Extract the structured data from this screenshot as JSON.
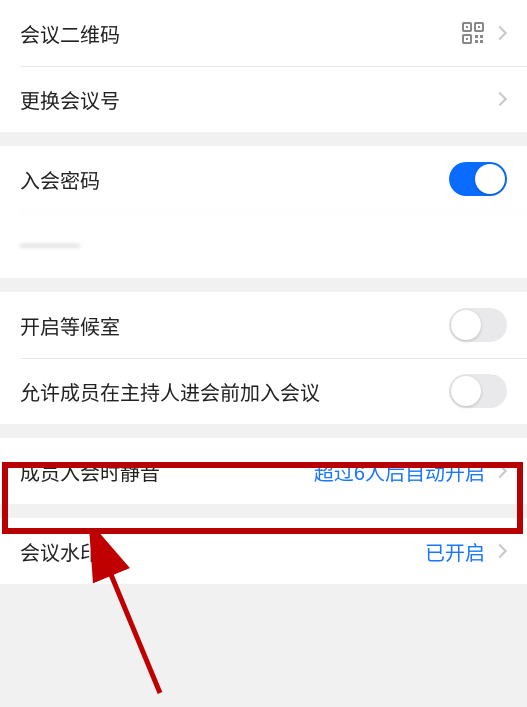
{
  "settings": {
    "qrcode": {
      "label": "会议二维码"
    },
    "changeNumber": {
      "label": "更换会议号"
    },
    "joinPassword": {
      "label": "入会密码",
      "enabled": true
    },
    "hiddenRow": {
      "label": "———"
    },
    "waitingRoom": {
      "label": "开启等候室",
      "enabled": false
    },
    "joinBeforeHost": {
      "label": "允许成员在主持人进会前加入会议",
      "enabled": false
    },
    "muteOnJoin": {
      "label": "成员入会时静音",
      "value": "超过6人后自动开启"
    },
    "watermark": {
      "label": "会议水印",
      "value": "已开启"
    }
  }
}
